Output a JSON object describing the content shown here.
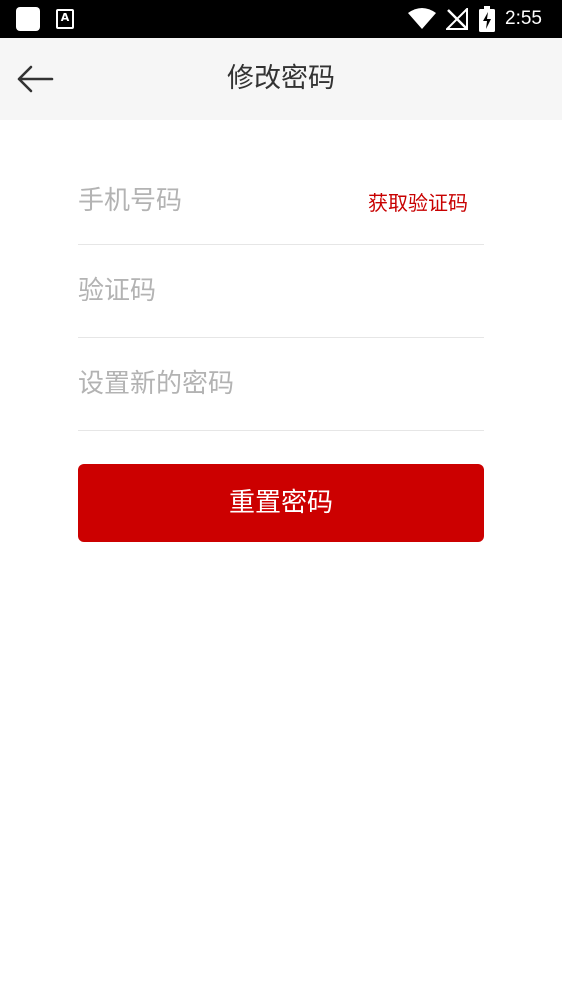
{
  "status_bar": {
    "time": "2:55",
    "icons": [
      "app-square-icon",
      "a-notification-icon",
      "wifi-icon",
      "no-signal-icon",
      "battery-charging-icon"
    ]
  },
  "header": {
    "title": "修改密码",
    "back_icon": "arrow-left-icon"
  },
  "form": {
    "phone_placeholder": "手机号码",
    "get_code_label": "获取验证码",
    "code_placeholder": "验证码",
    "new_password_placeholder": "设置新的密码"
  },
  "submit": {
    "label": "重置密码"
  },
  "colors": {
    "accent": "#cc0000",
    "header_bg": "#f6f6f6",
    "status_bar_bg": "#000000",
    "placeholder": "#b3b3b3",
    "divider": "#e6e6e6"
  }
}
